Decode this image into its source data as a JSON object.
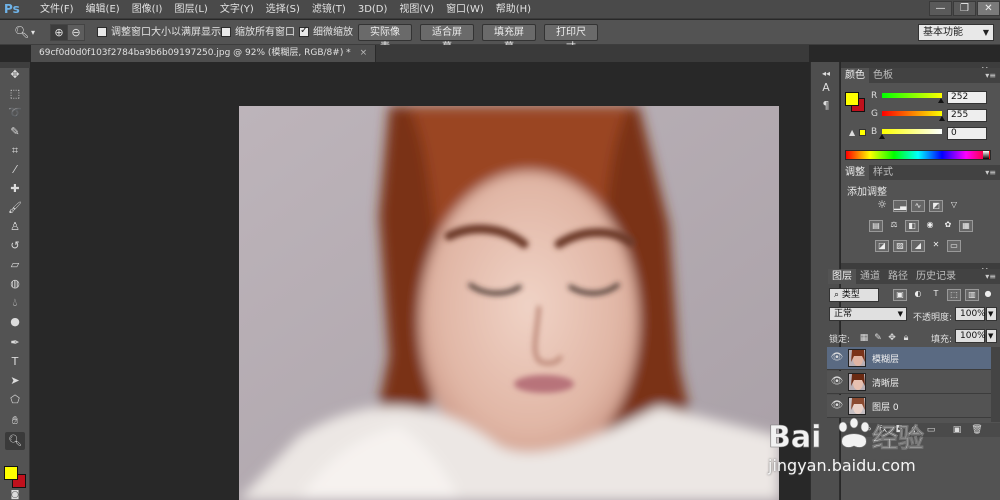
{
  "app": {
    "logo": "Ps"
  },
  "menu": [
    "文件(F)",
    "编辑(E)",
    "图像(I)",
    "图层(L)",
    "文字(Y)",
    "选择(S)",
    "滤镜(T)",
    "3D(D)",
    "视图(V)",
    "窗口(W)",
    "帮助(H)"
  ],
  "window_controls": {
    "minimize": "—",
    "restore": "❐",
    "close": "✕"
  },
  "options": {
    "resize_windows_label": "调整窗口大小以满屏显示",
    "zoom_all_label": "缩放所有窗口",
    "scrubby_zoom_label": "细微缩放",
    "resize_windows_checked": false,
    "zoom_all_checked": false,
    "scrubby_zoom_checked": true,
    "actual_pixels": "实际像素",
    "fit_screen": "适合屏幕",
    "fill_screen": "填充屏幕",
    "print_size": "打印尺寸",
    "workspace": "基本功能"
  },
  "document": {
    "tab_title": "69cf0d0d0f103f2784ba9b6b09197250.jpg @ 92% (模糊层, RGB/8#) *",
    "close": "×"
  },
  "colors": {
    "foreground": "#ffff00",
    "background": "#c0101c"
  },
  "color_panel": {
    "tabs": [
      "颜色",
      "色板"
    ],
    "r_label": "R",
    "g_label": "G",
    "b_label": "B",
    "r": 252,
    "g": 255,
    "b": 0,
    "r_value": "252",
    "g_value": "255",
    "b_value": "0"
  },
  "adjustments_panel": {
    "tabs": [
      "调整",
      "样式"
    ],
    "title": "添加调整"
  },
  "layers_panel": {
    "tabs": [
      "图层",
      "通道",
      "路径",
      "历史记录"
    ],
    "filter_kind": "类型",
    "blend_mode": "正常",
    "opacity_label": "不透明度:",
    "opacity_value": "100%",
    "lock_label": "锁定:",
    "fill_label": "填充:",
    "fill_value": "100%",
    "layers": [
      {
        "name": "模糊层",
        "selected": true
      },
      {
        "name": "清晰层",
        "selected": false
      },
      {
        "name": "图层 0",
        "selected": false
      }
    ]
  },
  "watermark": {
    "brand": "Bai",
    "brand_cn": "经验",
    "url": "jingyan.baidu.com"
  }
}
